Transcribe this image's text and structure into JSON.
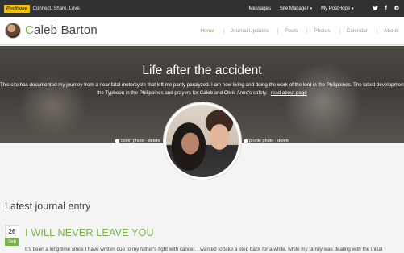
{
  "topbar": {
    "logo_text": "PostHope",
    "tagline": "Connect. Share. Love.",
    "nav": [
      {
        "label": "Messages",
        "caret": ""
      },
      {
        "label": "Site Manager",
        "caret": "▾"
      },
      {
        "label": "My PostHope",
        "caret": "▾"
      }
    ],
    "social": [
      {
        "name": "twitter-icon",
        "glyph": "🐦"
      },
      {
        "name": "facebook-icon",
        "glyph": "f"
      },
      {
        "name": "pinterest-icon",
        "glyph": "℗"
      }
    ]
  },
  "profile": {
    "first_initial": "C",
    "name_rest": "aleb Barton",
    "tabs": [
      {
        "label": "Home",
        "active": true
      },
      {
        "label": "Journal Updates",
        "active": false
      },
      {
        "label": "Posts",
        "active": false
      },
      {
        "label": "Photos",
        "active": false
      },
      {
        "label": "Calendar",
        "active": false
      },
      {
        "label": "About",
        "active": false
      }
    ]
  },
  "cover": {
    "title": "Life after the accident",
    "description_line1": "This site has documented my journey from a near fatal motorcycle that left me partly paralyzed. I am now living and doing the work of the lord in the Philippines. The latest development is",
    "description_line2": "the Typhoon in the Philippines and prayers for Caleb and Chris Anne's safety.",
    "read_more": "read about page",
    "cover_photo_action": "cover photo · delete",
    "profile_photo_action": "profile photo · delete"
  },
  "journal": {
    "section_title": "Latest journal entry",
    "day": "26",
    "month": "Sep",
    "title": "I WILL NEVER LEAVE YOU",
    "excerpt": "It's been a long time since I have written due to my father's fight with cancer. I wanted to take a step back for a while, while my family was dealing with the initial"
  },
  "colors": {
    "accent": "#7ab247",
    "topbar_bg": "#2f3133",
    "logo_bg": "#f6c100"
  }
}
